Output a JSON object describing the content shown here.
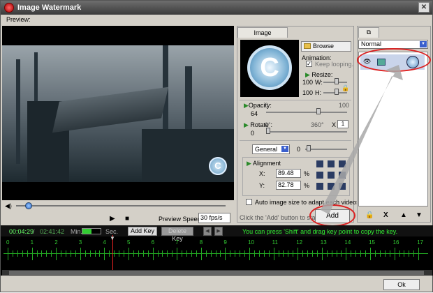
{
  "window": {
    "title": "Image Watermark",
    "close": "✕"
  },
  "preview": {
    "label": "Preview:"
  },
  "player": {
    "play": "▶",
    "stop": "■",
    "speed_label": "Preview Speed:",
    "speed_value": "30 fps/s",
    "seek": 0.06,
    "watermark_glyph": "C"
  },
  "watermark_tab": "Image Watermark",
  "image_settings": {
    "browse": "Browse",
    "animation_label": "Animation:",
    "keep_looping": "Keep looping.",
    "resize_label": "Resize:",
    "w_value": "100",
    "w_label": "W:",
    "h_value": "100",
    "h_label": "H:"
  },
  "opacity": {
    "label": "Opacity:",
    "min": "0",
    "max": "100",
    "value": "64"
  },
  "rotate": {
    "label": "Rotate :",
    "min": "0°",
    "max": "360°",
    "x": "X",
    "step": "1",
    "value": "0"
  },
  "general": {
    "select": "General",
    "value": "0"
  },
  "alignment": {
    "label": "Alignment",
    "x_label": "X:",
    "x_value": "89.48",
    "y_label": "Y:",
    "y_value": "82.78",
    "pct": "%"
  },
  "auto_image": "Auto image size to adapt each videos.",
  "add_hint": "Click the 'Add' button to start.",
  "add_button": "Add",
  "layers": {
    "mode": "Normal",
    "tools": [
      "🔒",
      "X",
      "▲",
      "▼"
    ],
    "eye": "👁"
  },
  "timeline": {
    "current": "00:04:29",
    "sep": "/",
    "total": "02:41:42",
    "min_label": "Min.",
    "sec_label": "Sec.",
    "zoom": 0.5,
    "add_key": "Add Key",
    "delete_key": "Delete Key",
    "prev": "◀",
    "next": "▶",
    "hint": "You can press 'Shift' and drag key point to copy the key.",
    "ticks": [
      "0",
      "1",
      "2",
      "3",
      "4",
      "5",
      "6",
      "7",
      "8",
      "9",
      "10",
      "11",
      "12",
      "13",
      "14",
      "15",
      "16",
      "17"
    ]
  },
  "ok_button": "Ok"
}
